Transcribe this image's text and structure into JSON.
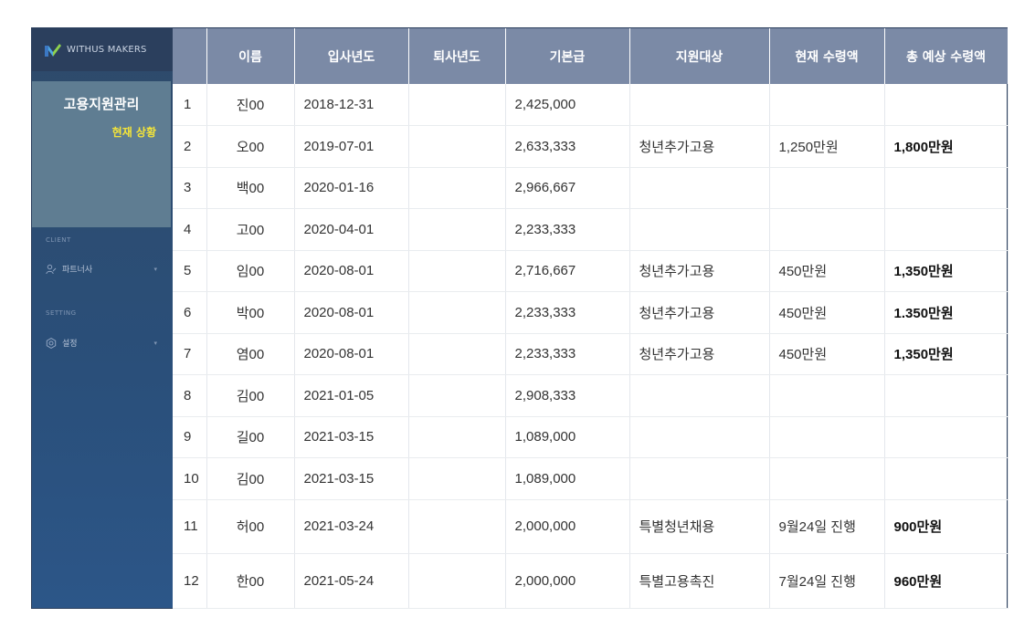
{
  "app": {
    "brand": "WITHUS MAKERS"
  },
  "sidebar": {
    "menu_title": "고용지원관리",
    "menu_sub": "현재 상황",
    "sections": [
      {
        "label": "CLIENT",
        "item": "파트너사"
      },
      {
        "label": "SETTING",
        "item": "설정"
      }
    ]
  },
  "table": {
    "headers": [
      "",
      "이름",
      "입사년도",
      "퇴사년도",
      "기본급",
      "지원대상",
      "현재 수령액",
      "총 예상 수령액"
    ],
    "rows": [
      {
        "no": "1",
        "name": "진00",
        "hired": "2018-12-31",
        "left": "",
        "salary": "2,425,000",
        "target": "",
        "current": "",
        "total": ""
      },
      {
        "no": "2",
        "name": "오00",
        "hired": "2019-07-01",
        "left": "",
        "salary": "2,633,333",
        "target": "청년추가고용",
        "current": "1,250만원",
        "total": "1,800만원"
      },
      {
        "no": "3",
        "name": "백00",
        "hired": "2020-01-16",
        "left": "",
        "salary": "2,966,667",
        "target": "",
        "current": "",
        "total": ""
      },
      {
        "no": "4",
        "name": "고00",
        "hired": "2020-04-01",
        "left": "",
        "salary": "2,233,333",
        "target": "",
        "current": "",
        "total": ""
      },
      {
        "no": "5",
        "name": "임00",
        "hired": "2020-08-01",
        "left": "",
        "salary": "2,716,667",
        "target": "청년추가고용",
        "current": "450만원",
        "total": "1,350만원"
      },
      {
        "no": "6",
        "name": "박00",
        "hired": "2020-08-01",
        "left": "",
        "salary": "2,233,333",
        "target": "청년추가고용",
        "current": "450만원",
        "total": "1.350만원"
      },
      {
        "no": "7",
        "name": "염00",
        "hired": "2020-08-01",
        "left": "",
        "salary": "2,233,333",
        "target": "청년추가고용",
        "current": "450만원",
        "total": "1,350만원"
      },
      {
        "no": "8",
        "name": "김00",
        "hired": "2021-01-05",
        "left": "",
        "salary": "2,908,333",
        "target": "",
        "current": "",
        "total": ""
      },
      {
        "no": "9",
        "name": "길00",
        "hired": "2021-03-15",
        "left": "",
        "salary": "1,089,000",
        "target": "",
        "current": "",
        "total": ""
      },
      {
        "no": "10",
        "name": "김00",
        "hired": "2021-03-15",
        "left": "",
        "salary": "1,089,000",
        "target": "",
        "current": "",
        "total": ""
      },
      {
        "no": "11",
        "name": "허00",
        "hired": "2021-03-24",
        "left": "",
        "salary": "2,000,000",
        "target": "특별청년채용",
        "current": "9월24일 진행",
        "total": "900만원"
      },
      {
        "no": "12",
        "name": "한00",
        "hired": "2021-05-24",
        "left": "",
        "salary": "2,000,000",
        "target": "특별고용촉진",
        "current": "7월24일 진행",
        "total": "960만원"
      }
    ]
  },
  "colors": {
    "header_bg": "#7b8aa6",
    "sidebar_bg": "#2a4f7a",
    "menu_box": "#5f7d92",
    "highlight": "#f3e43a"
  }
}
